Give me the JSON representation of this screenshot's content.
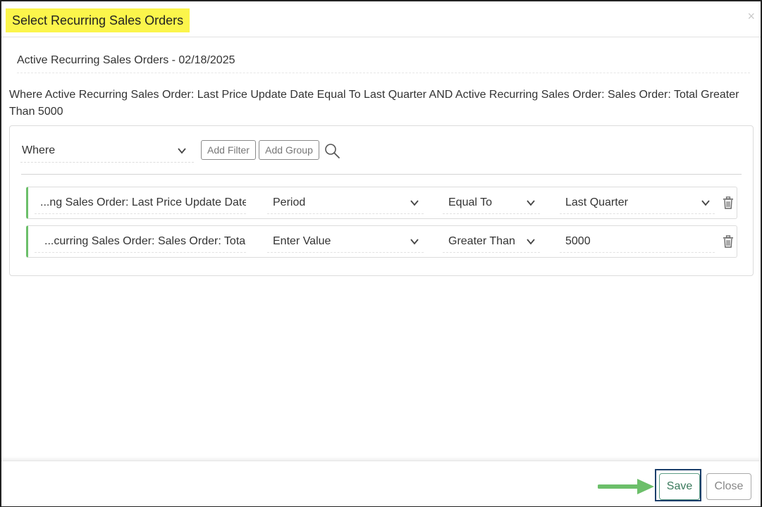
{
  "dialog": {
    "title": "Select Recurring Sales Orders",
    "close_glyph": "×",
    "subtitle": "Active Recurring Sales Orders - 02/18/2025",
    "description": "Where Active Recurring Sales Order: Last Price Update Date Equal To Last Quarter AND Active Recurring Sales Order: Sales Order: Total Greater Than 5000"
  },
  "filter_bar": {
    "where_value": "Where",
    "add_filter_label": "Add Filter",
    "add_group_label": "Add Group",
    "search_icon": "search-icon"
  },
  "filters": [
    {
      "field": "...ng Sales Order: Last Price Update Date",
      "value_type": "Period",
      "operator": "Equal To",
      "value": "Last Quarter"
    },
    {
      "field": "...curring Sales Order: Sales Order: Total",
      "value_type": "Enter Value",
      "operator": "Greater Than",
      "value": "5000"
    }
  ],
  "footer": {
    "save_label": "Save",
    "close_label": "Close"
  },
  "colors": {
    "title_highlight": "#fbf54b",
    "row_accent": "#6cbf6a",
    "arrow": "#6cbf6a",
    "save_outline": "#1b3e6b"
  }
}
